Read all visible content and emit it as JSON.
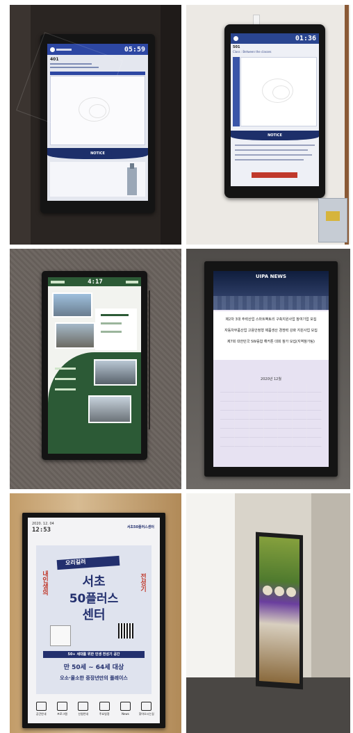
{
  "panels": [
    {
      "clock": "05:59",
      "room": "401",
      "notice": "NOTICE"
    },
    {
      "clock": "01:36",
      "room": "501",
      "class_line": "Class : Between the classes",
      "notice": "NOTICE"
    },
    {
      "clock": "4:17"
    },
    {
      "header": "UIPA NEWS",
      "news": [
        "제2차 3대 주력산업 스마트팩토리 구축지원사업 참여기업 모집",
        "자동차부품산업 고용안정형 제품생산 경쟁력 강화 지원사업 모집",
        "제7회 대한민국 SW융합 해커톤 대회 참가 모집(지역참가팀)"
      ],
      "calendar_title": "2020년 12월"
    },
    {
      "date": "2020. 12. 04",
      "clock": "12:53",
      "poster": {
        "brand": "서초50플러스센터",
        "ribbon": "오리길러",
        "side_left": "내인생의",
        "side_right": "전성기",
        "title_line1": "서초",
        "title_line2": "50플러스",
        "title_line3": "센터",
        "subtitle": "50+ 세대를 위한 인생 전성기 공간",
        "range": "만 50세 ~ 64세 대상",
        "bottom": "오소·올소한 중장년만의 플레이스"
      },
      "menu": [
        "공간안내",
        "프로그램",
        "신청안내",
        "주요일정",
        "News",
        "찾아오시는길"
      ]
    },
    {}
  ],
  "colors": {
    "navy": "#1d2f6a",
    "green": "#2c5a36",
    "lavender": "#e7e2f2",
    "poster_blue": "#23306e"
  }
}
